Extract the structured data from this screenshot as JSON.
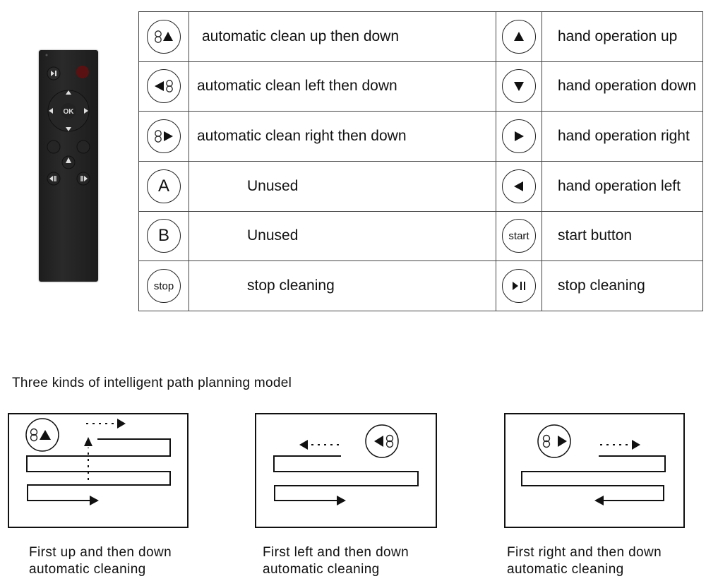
{
  "table": {
    "rows": [
      {
        "left_icon": "auto-up-icon",
        "left_label": "automatic clean up then down",
        "right_icon": "up-arrow-icon",
        "right_label": "hand operation up"
      },
      {
        "left_icon": "auto-left-icon",
        "left_label": "automatic clean left then down",
        "right_icon": "down-arrow-icon",
        "right_label": "hand operation down"
      },
      {
        "left_icon": "auto-right-icon",
        "left_label": "automatic clean right then down",
        "right_icon": "right-arrow-icon",
        "right_label": "hand operation right"
      },
      {
        "left_icon": "A",
        "left_label": "Unused",
        "right_icon": "left-arrow-icon",
        "right_label": "hand operation left"
      },
      {
        "left_icon": "B",
        "left_label": "Unused",
        "right_icon": "start",
        "right_label": "start button"
      },
      {
        "left_icon": "stop",
        "left_label": "stop cleaning",
        "right_icon": "play-pause-icon",
        "right_label": "stop cleaning"
      }
    ]
  },
  "remote": {
    "ok_label": "OK",
    "power_color": "#8b1a1a"
  },
  "section": {
    "heading": "Three kinds of intelligent path planning model",
    "captions": [
      {
        "line1": "First up and then down",
        "line2": "automatic cleaning"
      },
      {
        "line1": "First left and then down",
        "line2": "automatic cleaning"
      },
      {
        "line1": "First right and then down",
        "line2": "automatic cleaning"
      }
    ]
  }
}
